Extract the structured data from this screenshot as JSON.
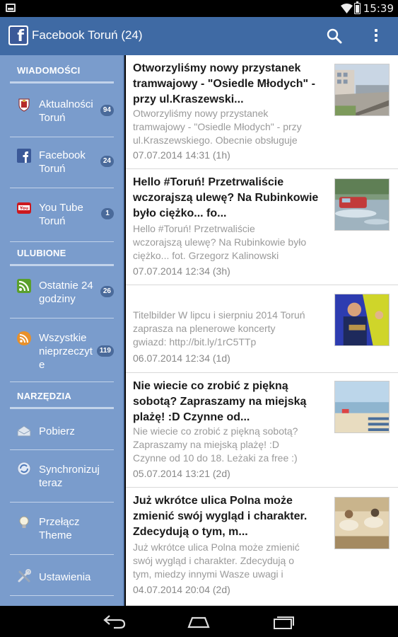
{
  "status_bar": {
    "time": "15:39"
  },
  "action_bar": {
    "title": "Facebook Toruń (24)",
    "logo_letter": "f",
    "search_icon": "search-icon",
    "menu_icon": "overflow-menu-icon"
  },
  "sidebar": {
    "sections": [
      {
        "title": "WIADOMOŚCI"
      },
      {
        "title": "ULUBIONE"
      },
      {
        "title": "NARZĘDZIA"
      }
    ],
    "items": [
      {
        "label_line1": "Aktualności",
        "label_line2": "Toruń",
        "label_line3": "",
        "count": "94",
        "icon": "torun-crest-icon"
      },
      {
        "label_line1": "Facebook",
        "label_line2": "Toruń",
        "label_line3": "",
        "count": "24",
        "icon": "facebook-icon"
      },
      {
        "label_line1": "You Tube",
        "label_line2": "Toruń",
        "label_line3": "",
        "count": "1",
        "icon": "youtube-icon"
      },
      {
        "label_line1": "Ostatnie 24",
        "label_line2": "godziny",
        "label_line3": "",
        "count": "26",
        "icon": "rss-icon"
      },
      {
        "label_line1": "Wszystkie",
        "label_line2": "nieprzeczyt",
        "label_line3": "e",
        "count": "119",
        "icon": "rss-orange-icon"
      },
      {
        "label_line1": "Pobierz",
        "label_line2": "",
        "label_line3": "",
        "count": "",
        "icon": "download-icon"
      },
      {
        "label_line1": "Synchronizuj",
        "label_line2": "teraz",
        "label_line3": "",
        "count": "",
        "icon": "sync-icon"
      },
      {
        "label_line1": "Przełącz",
        "label_line2": "Theme",
        "label_line3": "",
        "count": "",
        "icon": "bulb-icon"
      },
      {
        "label_line1": "Ustawienia",
        "label_line2": "",
        "label_line3": "",
        "count": "",
        "icon": "tools-icon"
      }
    ]
  },
  "feed": {
    "posts": [
      {
        "title": [
          "Otworzyliśmy nowy przystanek",
          "tramwajowy - \"Osiedle Młodych\" -",
          "przy ul.Kraszewski..."
        ],
        "body": [
          "Otworzyliśmy nowy przystanek",
          "tramwajowy - \"Osiedle Młodych\" - przy",
          "ul.Kraszewskiego. Obecnie obsługuje"
        ],
        "date": "07.07.2014 14:31 (1h)"
      },
      {
        "title": [
          "Hello #Toruń! Przetrwaliście",
          "wczorajszą ulewę? Na Rubinkowie",
          "było ciężko... fo..."
        ],
        "body": [
          "Hello #Toruń! Przetrwaliście",
          "wczorajszą ulewę? Na Rubinkowie było",
          "ciężko... fot. Grzegorz Kalinowski"
        ],
        "date": "07.07.2014 12:34 (3h)"
      },
      {
        "title": [],
        "body": [
          "Titelbilder W lipcu i sierpniu 2014 Toruń",
          "zaprasza na plenerowe koncerty",
          "gwiazd: http://bit.ly/1rC5TTp"
        ],
        "date": "06.07.2014 12:34 (1d)"
      },
      {
        "title": [
          "Nie wiecie co zrobić z piękną",
          "sobotą? Zapraszamy na miejską",
          "plażę! :D Czynne od..."
        ],
        "body": [
          "Nie wiecie co zrobić z piękną sobotą?",
          "Zapraszamy na miejską plażę! :D",
          "Czynne od 10 do 18. Leżaki za free :)"
        ],
        "date": "05.07.2014 13:21 (2d)"
      },
      {
        "title": [
          "Już wkrótce ulica Polna może",
          "zmienić swój wygląd i charakter.",
          "Zdecydują o tym, m..."
        ],
        "body": [
          "Już wkrótce ulica Polna może zmienić",
          "swój wygląd i charakter. Zdecydują o",
          "tym, miedzy innymi Wasze uwagi i"
        ],
        "date": "04.07.2014 20:04 (2d)"
      }
    ]
  },
  "nav_bar": {
    "back_icon": "back-icon",
    "home_icon": "home-icon",
    "recents_icon": "recents-icon"
  }
}
